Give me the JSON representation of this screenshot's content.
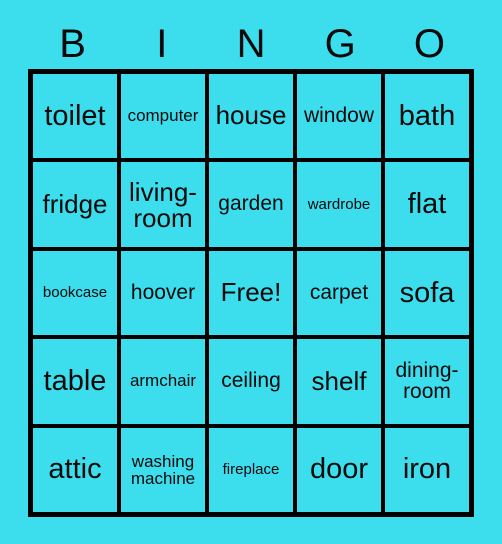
{
  "card": {
    "background_color": "#3cdeee",
    "border_color": "#000000",
    "text_color": "#0a0a0a",
    "headers": [
      {
        "label": "B"
      },
      {
        "label": "I"
      },
      {
        "label": "N"
      },
      {
        "label": "G"
      },
      {
        "label": "O"
      }
    ],
    "rows": [
      [
        {
          "label": "toilet",
          "size": "fs-xl"
        },
        {
          "label": "computer",
          "size": "fs-sm"
        },
        {
          "label": "house",
          "size": "fs-lg"
        },
        {
          "label": "window",
          "size": "fs-md"
        },
        {
          "label": "bath",
          "size": "fs-xl"
        }
      ],
      [
        {
          "label": "fridge",
          "size": "fs-lg"
        },
        {
          "label": "living-\nroom",
          "size": "fs-lg"
        },
        {
          "label": "garden",
          "size": "fs-md"
        },
        {
          "label": "wardrobe",
          "size": "fs-xs"
        },
        {
          "label": "flat",
          "size": "fs-xl"
        }
      ],
      [
        {
          "label": "bookcase",
          "size": "fs-xs"
        },
        {
          "label": "hoover",
          "size": "fs-md"
        },
        {
          "label": "Free!",
          "size": "fs-lg"
        },
        {
          "label": "carpet",
          "size": "fs-md"
        },
        {
          "label": "sofa",
          "size": "fs-xl"
        }
      ],
      [
        {
          "label": "table",
          "size": "fs-xl"
        },
        {
          "label": "armchair",
          "size": "fs-sm"
        },
        {
          "label": "ceiling",
          "size": "fs-md"
        },
        {
          "label": "shelf",
          "size": "fs-lg"
        },
        {
          "label": "dining-\nroom",
          "size": "fs-md"
        }
      ],
      [
        {
          "label": "attic",
          "size": "fs-xl"
        },
        {
          "label": "washing\nmachine",
          "size": "fs-sm"
        },
        {
          "label": "fireplace",
          "size": "fs-xs"
        },
        {
          "label": "door",
          "size": "fs-xl"
        },
        {
          "label": "iron",
          "size": "fs-xl"
        }
      ]
    ]
  }
}
